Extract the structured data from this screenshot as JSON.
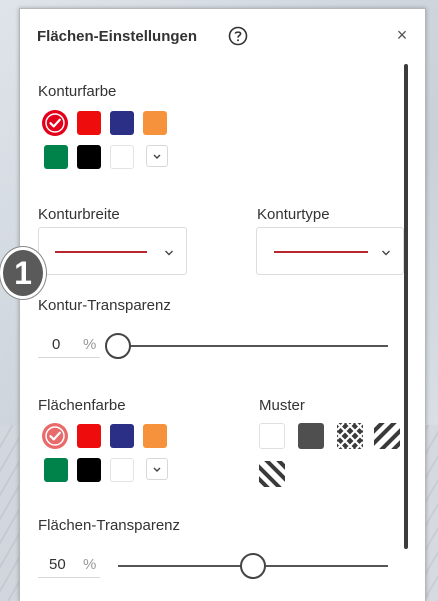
{
  "dialog": {
    "title": "Flächen-Einstellungen",
    "close_glyph": "×"
  },
  "outline": {
    "color_label": "Konturfarbe",
    "width_label": "Konturbreite",
    "type_label": "Konturtype",
    "transparency_label": "Kontur-Transparenz",
    "transparency_value": "0",
    "transparency_unit": "%",
    "transparency_percent": 0,
    "selected_color": "#e2001a",
    "colors": [
      "#e2001a",
      "#ee0c0c",
      "#2b2f86",
      "#f6923c",
      "#00834a",
      "#000000",
      "#ffffff"
    ]
  },
  "fill": {
    "color_label": "Flächenfarbe",
    "pattern_label": "Muster",
    "transparency_label": "Flächen-Transparenz",
    "transparency_value": "50",
    "transparency_unit": "%",
    "transparency_percent": 50,
    "selected_color": "#e86a6a",
    "colors": [
      "#e86a6a",
      "#ee0c0c",
      "#2b2f86",
      "#f6923c",
      "#00834a",
      "#000000",
      "#ffffff"
    ],
    "patterns": [
      "blank",
      "solid-dark",
      "crosshatch",
      "diagonal-right",
      "diagonal-left"
    ]
  },
  "callout": {
    "number": "1"
  },
  "icons": {
    "help": "help-icon",
    "close": "close-icon",
    "chevron": "chevron-down-icon",
    "check": "check-icon"
  }
}
